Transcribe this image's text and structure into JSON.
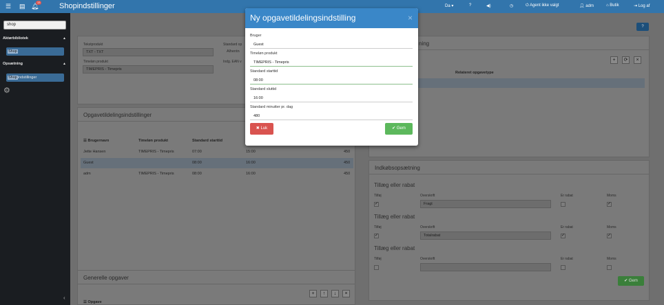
{
  "topbar": {
    "title": "Shopindstillinger",
    "notification_count": "13",
    "lang": "Da",
    "agent_label": "Agent ikke valgt",
    "user_label": "adm",
    "shop_label": "Butik",
    "logout_label": "Log af"
  },
  "sidebar": {
    "search_value": "shop",
    "section1": "Aktørbibliotek",
    "item1": "Shop",
    "section2": "Opsætning",
    "item2_hl": "Shop",
    "item2_rest": "indstillinger"
  },
  "settings_panel": {
    "tekstprodukt_label": "Tekstprodukt",
    "tekstprodukt_value": "TXT - TXT",
    "timelon_label": "Timeløn produkt",
    "timelon_value": "TIMEPRIS - Timepris",
    "standard_label": "Standard op",
    "standard_value": "Alhentn",
    "ean_label": "Indg. EAN v"
  },
  "task_settings": {
    "title": "Opgavetildelingsindstillinger",
    "columns": [
      "Brugernavn",
      "Timeløn produkt",
      "Standard starttid"
    ],
    "rows": [
      {
        "user": "Jette Hansen",
        "product": "TIMEPRIS - Timepris",
        "start": "07:00",
        "end": "15:00",
        "minutes": "450"
      },
      {
        "user": "Guest",
        "product": "",
        "start": "08:00",
        "end": "16:00",
        "minutes": "450"
      },
      {
        "user": "adm",
        "product": "TIMEPRIS - Timepris",
        "start": "08:00",
        "end": "16:00",
        "minutes": "450"
      }
    ]
  },
  "generic_tasks": {
    "title": "Generelle opgaver",
    "first_col": "Opgave"
  },
  "right_panel": {
    "title_fragment": "ning",
    "column": "Relateret opgavetype"
  },
  "purchase": {
    "title": "Indkøbsopsætning",
    "group_title": "Tillæg eller rabat",
    "col_tilfoj": "Tilføj",
    "col_overskrift": "Overskrift",
    "col_rabat": "Er rabat",
    "col_moms": "Moms",
    "groups": [
      {
        "title": "Tillæg eller rabat",
        "value": "Fragt",
        "tilfoj": "✓",
        "rabat": "",
        "moms": "✓"
      },
      {
        "title": "Tillæg eller rabat",
        "value": "Totalrabat",
        "tilfoj": "✓",
        "rabat": "✓",
        "moms": "✓"
      },
      {
        "title": "Tillæg eller rabat",
        "value": "",
        "tilfoj": "",
        "rabat": "",
        "moms": ""
      }
    ],
    "save_label": "Gem"
  },
  "modal": {
    "title": "Ny opgavetildelingsindstilling",
    "close_glyph": "×",
    "fields": [
      {
        "label": "Bruger",
        "value": "Guest"
      },
      {
        "label": "Timeløn produkt",
        "value": "TIMEPRIS - Timepris"
      },
      {
        "label": "Standard starttid",
        "value": "08:00"
      },
      {
        "label": "Standard sluttid",
        "value": "16:00"
      },
      {
        "label": "Standard minutter pr. dag",
        "value": "480"
      }
    ],
    "cancel_label": "Luk",
    "save_label": "Gem"
  },
  "colors": {
    "topbar": "#3275ac",
    "modal_header": "#3a87c8",
    "danger": "#d9534f",
    "success": "#5cb85c"
  }
}
